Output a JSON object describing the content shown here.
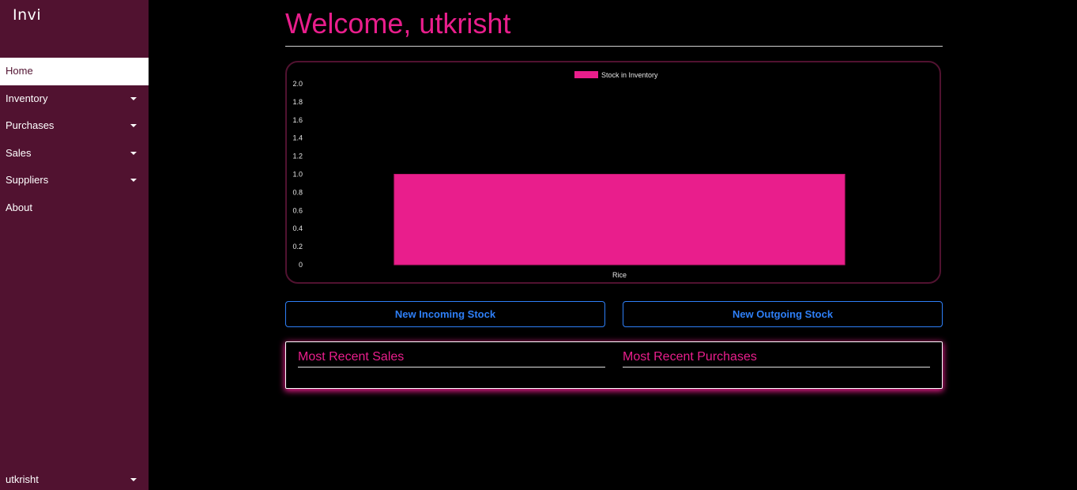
{
  "app": {
    "logo": "Invi"
  },
  "sidebar": {
    "items": [
      {
        "label": "Home",
        "active": true,
        "has_dropdown": false
      },
      {
        "label": "Inventory",
        "active": false,
        "has_dropdown": true
      },
      {
        "label": "Purchases",
        "active": false,
        "has_dropdown": true
      },
      {
        "label": "Sales",
        "active": false,
        "has_dropdown": true
      },
      {
        "label": "Suppliers",
        "active": false,
        "has_dropdown": true
      },
      {
        "label": "About",
        "active": false,
        "has_dropdown": false
      }
    ],
    "user": {
      "label": "utkrisht",
      "icon": "caret-down-icon"
    }
  },
  "main": {
    "title": "Welcome, utkrisht",
    "actions": {
      "incoming_label": "New Incoming Stock",
      "outgoing_label": "New Outgoing Stock"
    },
    "recent": {
      "sales_title": "Most Recent Sales",
      "purchases_title": "Most Recent Purchases"
    }
  },
  "colors": {
    "accent": "#e91e8c",
    "sidebar_bg": "#511230",
    "button_blue": "#2e7ff7",
    "background": "#000000"
  },
  "chart_data": {
    "type": "bar",
    "categories": [
      "Rice"
    ],
    "series": [
      {
        "name": "Stock in Inventory",
        "values": [
          1
        ],
        "color": "#e91e8c"
      }
    ],
    "ylim": [
      0,
      2
    ],
    "yticks": [
      "0",
      "0.2",
      "0.4",
      "0.6",
      "0.8",
      "1.0",
      "1.2",
      "1.4",
      "1.6",
      "1.8",
      "2.0"
    ],
    "legend": "top-center",
    "grid": false
  }
}
